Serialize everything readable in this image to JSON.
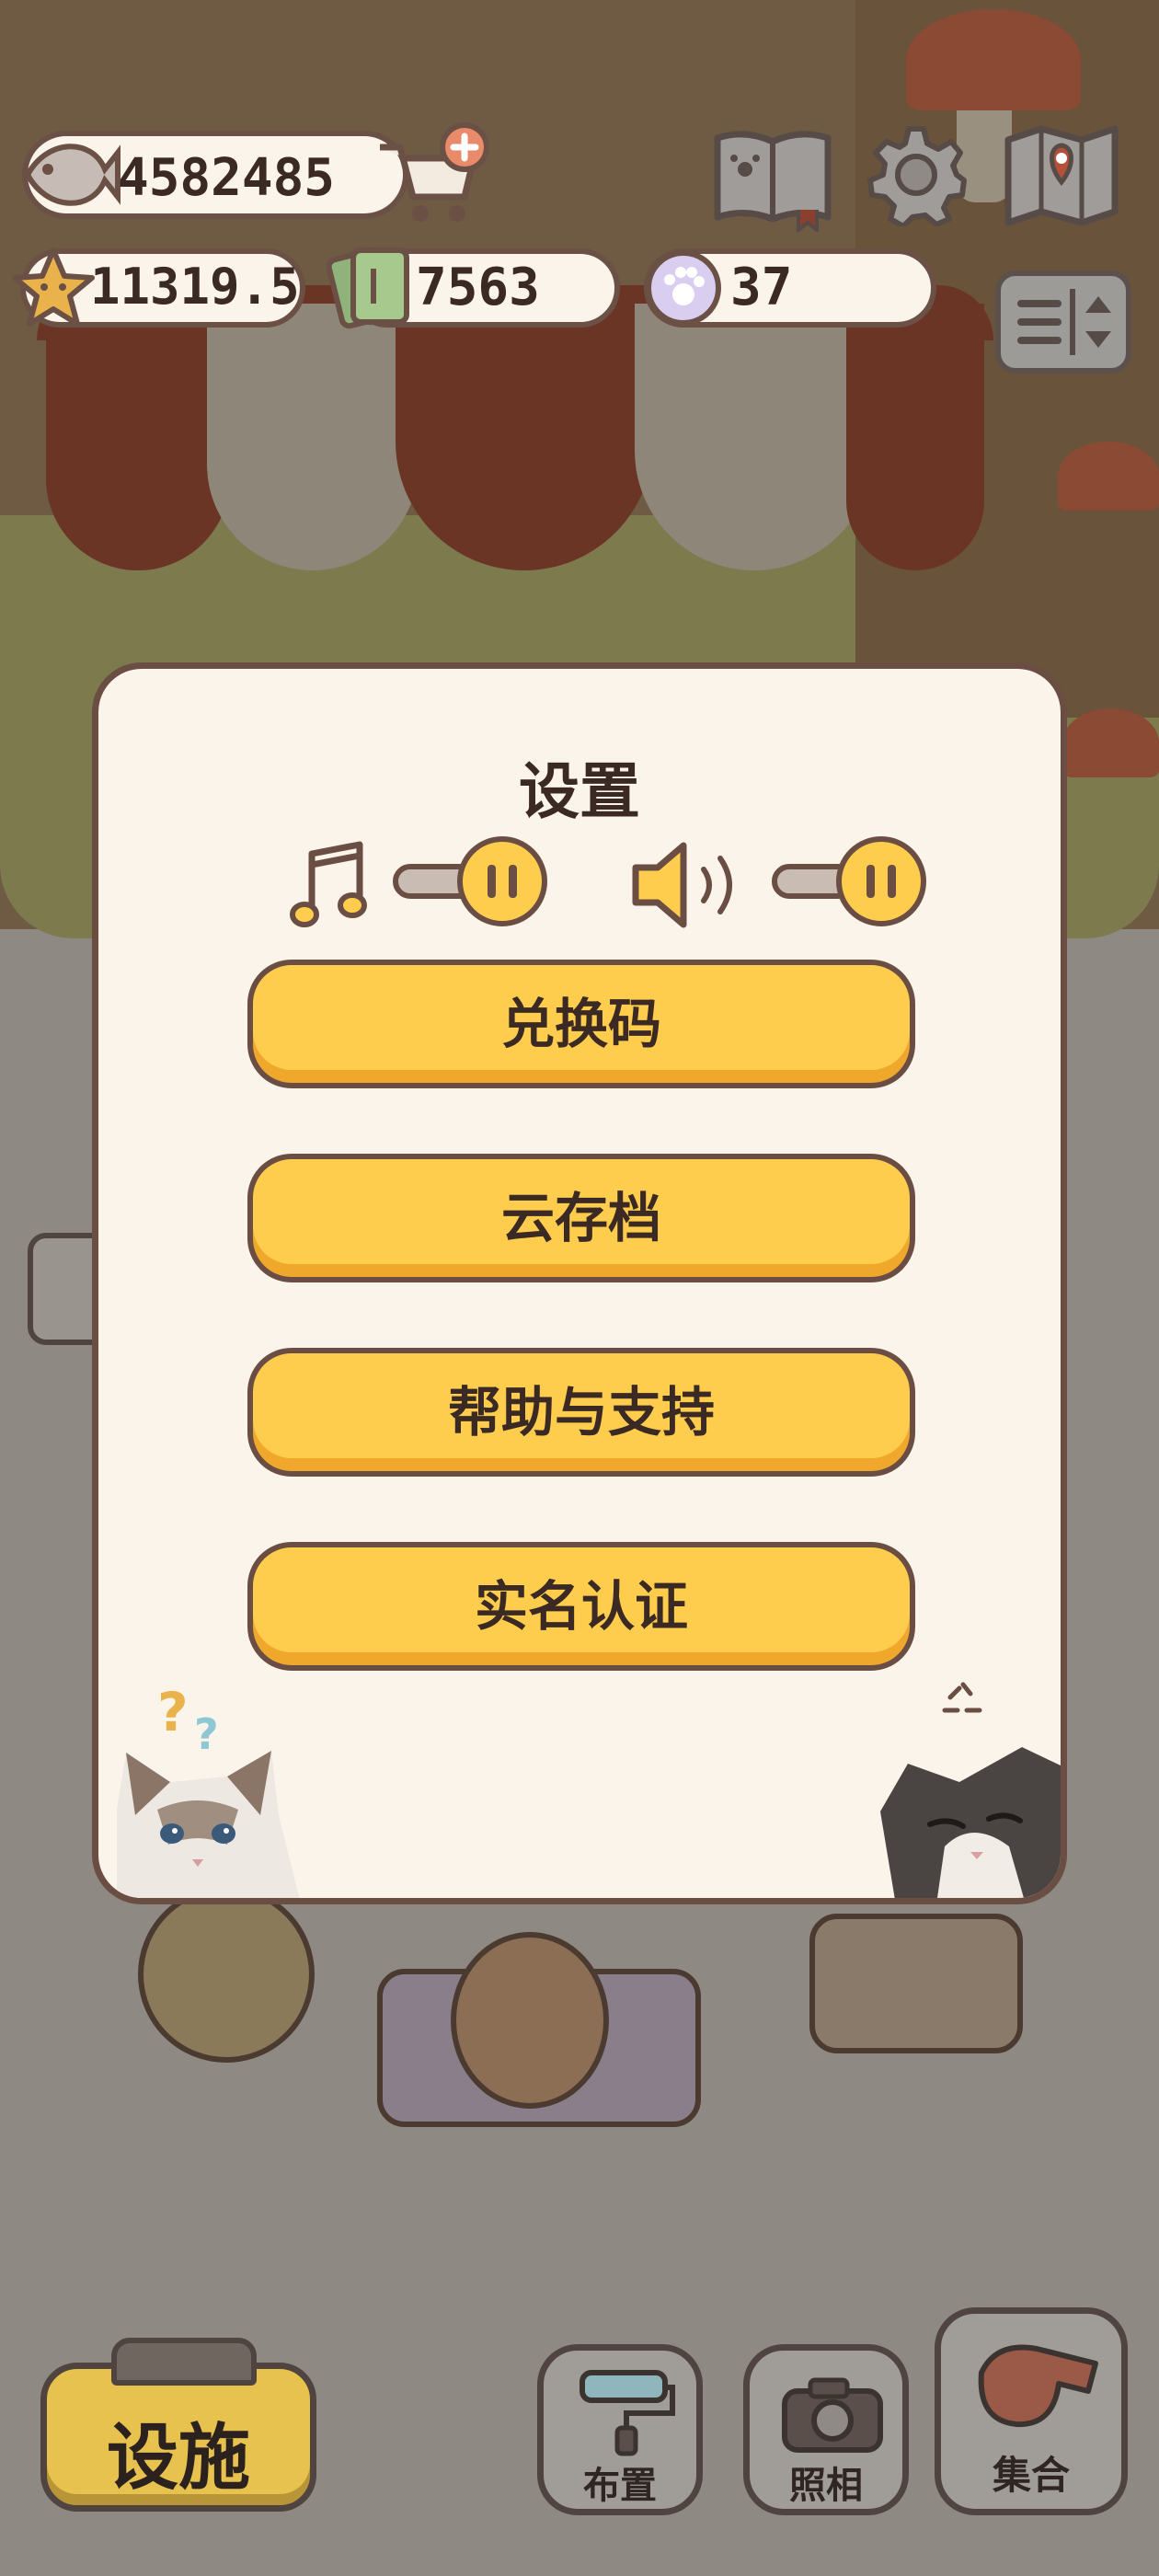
{
  "hud": {
    "fish": "4582485",
    "stars": "11319.5",
    "tickets": "7563",
    "paws": "37"
  },
  "settings_dialog": {
    "title": "设置",
    "music_level": 1.0,
    "sound_level": 1.0,
    "buttons": [
      "兑换码",
      "云存档",
      "帮助与支持",
      "实名认证"
    ]
  },
  "bottom_bar": {
    "facilities": "设施",
    "layout": "布置",
    "photo": "照相",
    "gather": "集合"
  },
  "icons": [
    "fish-icon",
    "cart-add-icon",
    "star-icon",
    "ticket-icon",
    "paw-icon",
    "book-icon",
    "gear-icon",
    "map-icon",
    "sort-icon",
    "music-note-icon",
    "speaker-icon",
    "roller-icon",
    "camera-icon",
    "whistle-icon"
  ],
  "colors": {
    "accent_yellow": "#ffcd4d",
    "dialog_bg": "#fbf4ea",
    "outline_brown": "#6b4e43"
  }
}
